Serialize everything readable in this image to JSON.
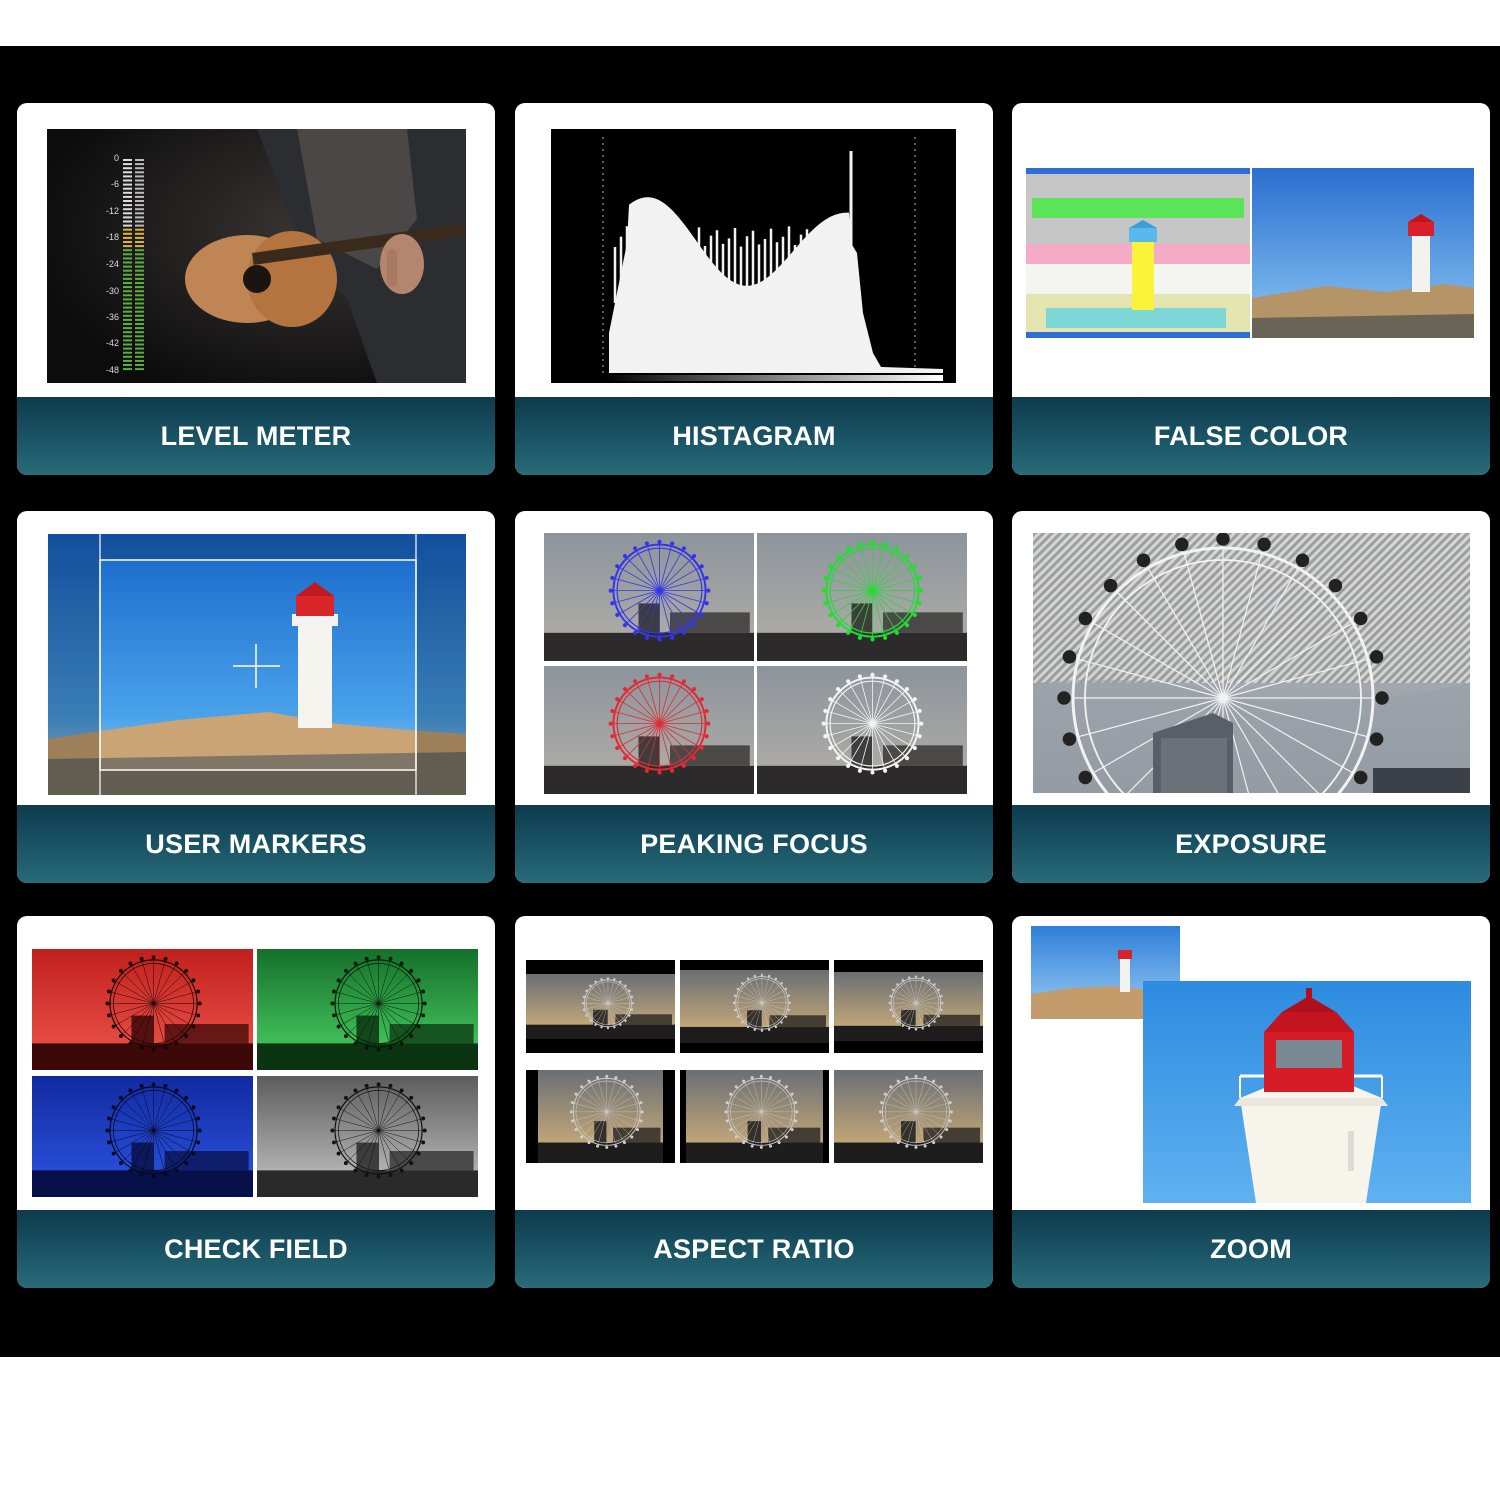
{
  "features": [
    {
      "id": "level",
      "label": "LEVEL METER",
      "image": "guitar-with-audio-level-meter"
    },
    {
      "id": "histogram",
      "label": "HISTAGRAM",
      "image": "luminance-histogram"
    },
    {
      "id": "falsecolor",
      "label": "FALSE COLOR",
      "image": "lighthouse-false-color-comparison"
    },
    {
      "id": "markers",
      "label": "USER MARKERS",
      "image": "lighthouse-with-safe-area-markers"
    },
    {
      "id": "peaking",
      "label": "PEAKING FOCUS",
      "image": "ferris-wheel-peaking-colors"
    },
    {
      "id": "exposure",
      "label": "EXPOSURE",
      "image": "ferris-wheel-zebra-stripes"
    },
    {
      "id": "checkfield",
      "label": "CHECK FIELD",
      "image": "ferris-wheel-rgb-mono-channels"
    },
    {
      "id": "aspect",
      "label": "ASPECT RATIO",
      "image": "ferris-wheel-aspect-ratio-frames"
    },
    {
      "id": "zoom",
      "label": "ZOOM",
      "image": "lighthouse-zoomed-detail"
    }
  ],
  "level_meter": {
    "scale_labels": [
      "0",
      "-6",
      "-12",
      "-18",
      "-24",
      "-30",
      "-36",
      "-42",
      "-48"
    ]
  },
  "colors": {
    "banner_dark": "#0d3b4c",
    "banner_light": "#2a6b78",
    "background": "#000000"
  }
}
